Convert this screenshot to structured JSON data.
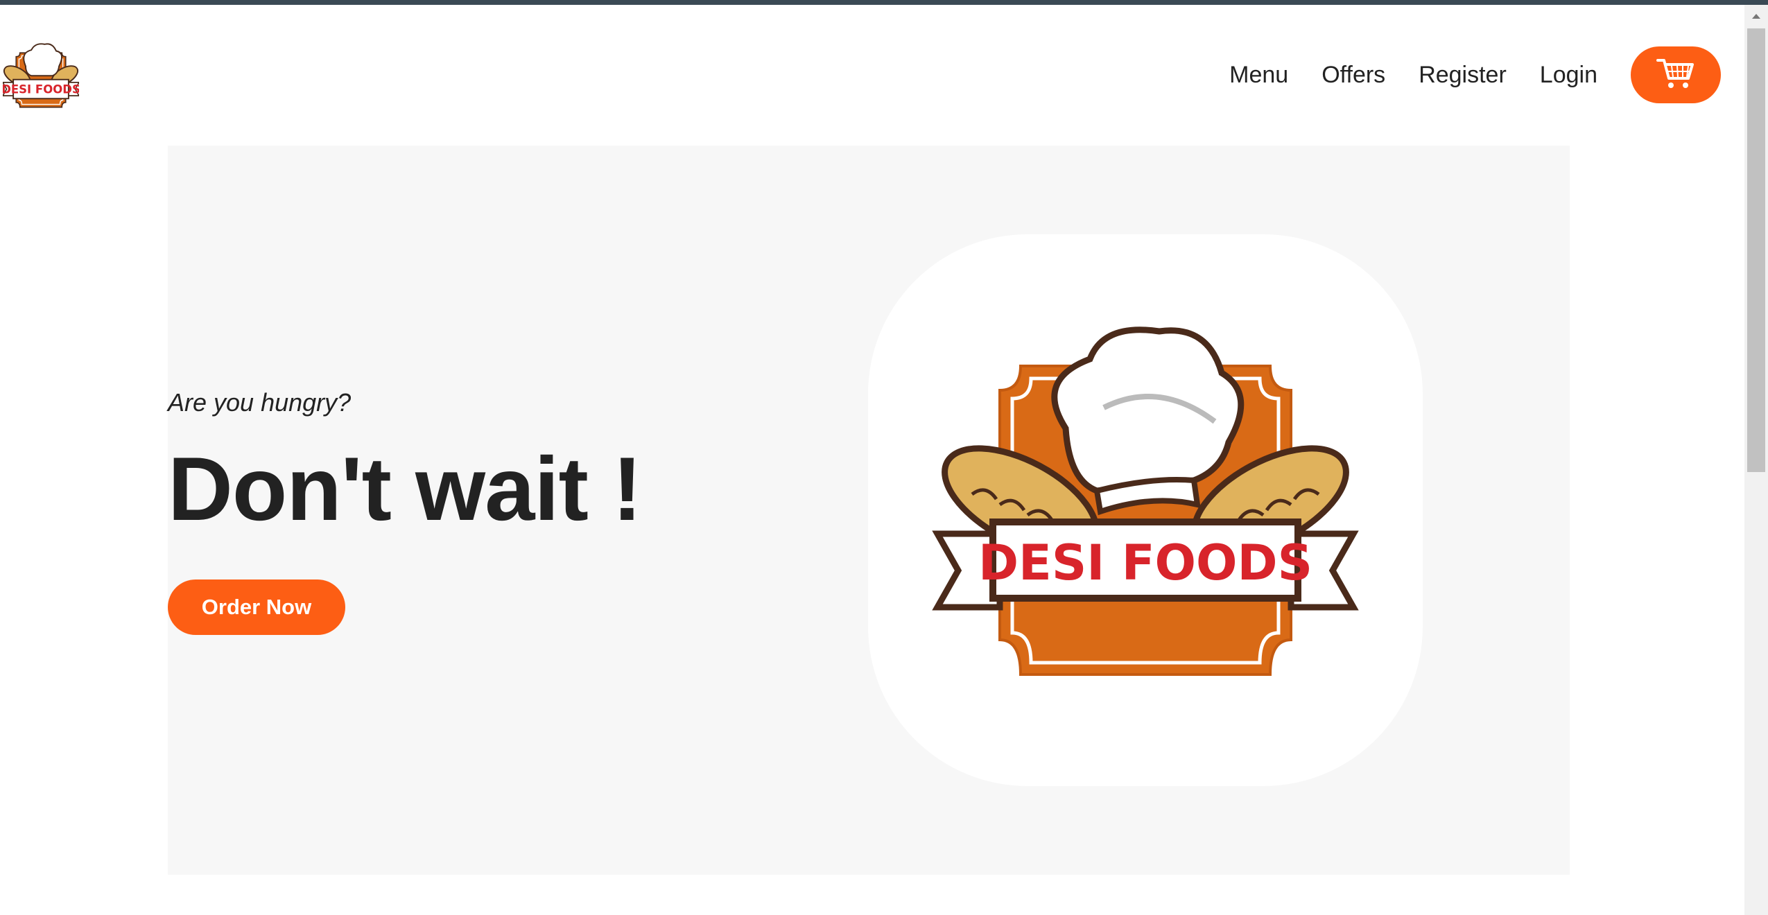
{
  "brand": {
    "logo_text": "DESI FOODS"
  },
  "nav": {
    "items": [
      {
        "label": "Menu"
      },
      {
        "label": "Offers"
      },
      {
        "label": "Register"
      },
      {
        "label": "Login"
      }
    ]
  },
  "hero": {
    "subtitle": "Are you hungry?",
    "title": "Don't wait !",
    "cta_label": "Order Now"
  },
  "icons": {
    "logo": "desi-foods-logo",
    "cart": "cart-icon",
    "scroll_up": "chevron-up-icon"
  },
  "colors": {
    "accent": "#fd5e14",
    "hero_bg": "#f7f7f7",
    "logo_orange": "#d96a16",
    "logo_red": "#d8242b",
    "logo_brown": "#4a2a1a",
    "bread": "#e0b25c"
  }
}
